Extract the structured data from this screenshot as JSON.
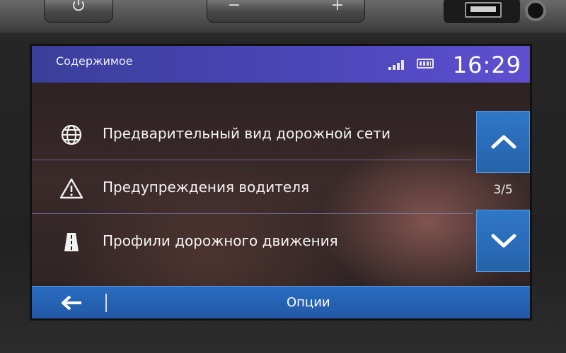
{
  "device": {
    "volume_minus": "−",
    "volume_plus": "+"
  },
  "status": {
    "title": "Содержимое",
    "time": "16:29"
  },
  "menu": {
    "items": [
      {
        "label": "Предварительный вид дорожной сети",
        "icon": "globe-icon"
      },
      {
        "label": "Предупреждения водителя",
        "icon": "warning-icon"
      },
      {
        "label": "Профили дорожного движения",
        "icon": "road-icon"
      }
    ]
  },
  "pagination": {
    "indicator": "3/5"
  },
  "footer": {
    "options_label": "Опции"
  },
  "colors": {
    "status_bar": "#4a46b8",
    "accent_blue": "#2563aa"
  }
}
